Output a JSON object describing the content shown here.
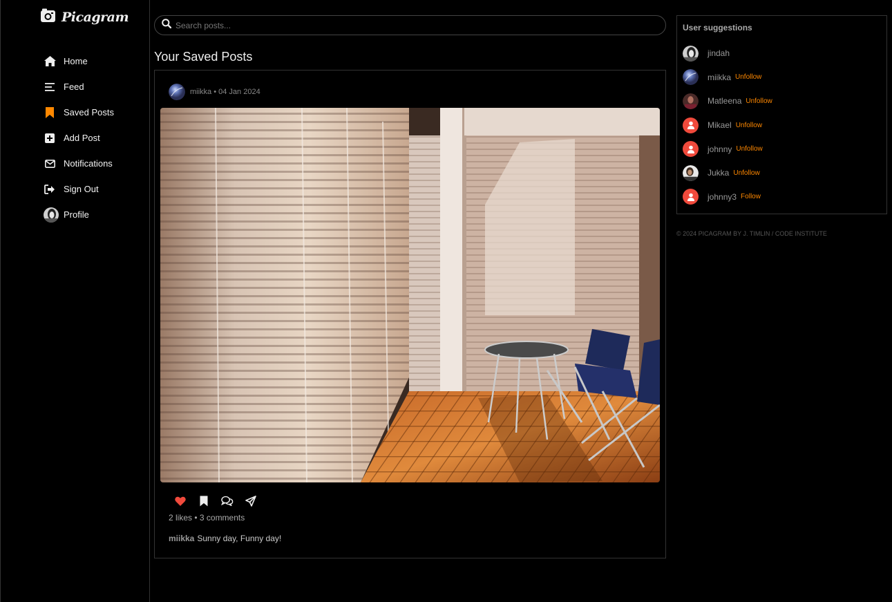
{
  "brand": {
    "title": "Picagram",
    "icon": "camera-icon"
  },
  "nav": {
    "items": [
      {
        "label": "Home",
        "icon": "home-icon"
      },
      {
        "label": "Feed",
        "icon": "feed-icon"
      },
      {
        "label": "Saved Posts",
        "icon": "bookmark-icon",
        "active": true
      },
      {
        "label": "Add Post",
        "icon": "plus-square-icon"
      },
      {
        "label": "Notifications",
        "icon": "envelope-icon"
      },
      {
        "label": "Sign Out",
        "icon": "sign-out-icon"
      },
      {
        "label": "Profile",
        "icon": "avatar"
      }
    ]
  },
  "search": {
    "placeholder": "Search posts..."
  },
  "page": {
    "title": "Your Saved Posts"
  },
  "post": {
    "author": "miikka",
    "date": "04 Jan 2024",
    "meta": "miikka • 04 Jan 2024",
    "stats": "2 likes • 3 comments",
    "caption_user": "miikka",
    "caption_text": "Sunny day, Funny day!",
    "liked": true
  },
  "suggestions": {
    "title": "User suggestions",
    "users": [
      {
        "name": "jindah",
        "action": ""
      },
      {
        "name": "miikka",
        "action": "Unfollow"
      },
      {
        "name": "Matleena",
        "action": "Unfollow"
      },
      {
        "name": "Mikael",
        "action": "Unfollow"
      },
      {
        "name": "johnny",
        "action": "Unfollow"
      },
      {
        "name": "Jukka",
        "action": "Unfollow"
      },
      {
        "name": "johnny3",
        "action": "Follow"
      }
    ]
  },
  "footer": {
    "text": "© 2024 Picagram by J. Timlin / Code Institute"
  },
  "colors": {
    "accent": "#ff8800",
    "like": "#f04a3c",
    "background": "#000000"
  }
}
